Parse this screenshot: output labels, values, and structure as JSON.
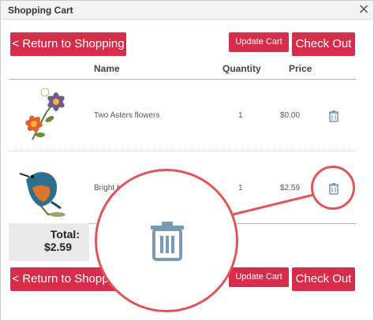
{
  "window": {
    "title": "Shopping Cart",
    "close_glyph": "×"
  },
  "buttons": {
    "return_label": "< Return to Shopping",
    "update_label": "Update Cart",
    "checkout_label": "Check Out"
  },
  "table": {
    "headers": {
      "name": "Name",
      "quantity": "Quantity",
      "price": "Price"
    },
    "rows": [
      {
        "name": "Two Asters flowers",
        "quantity": "1",
        "price": "$0.00",
        "image_icon": "asters-embroidery-icon"
      },
      {
        "name": "Bright b",
        "quantity": "1",
        "price": "$2.59",
        "image_icon": "kingfisher-embroidery-icon"
      }
    ]
  },
  "total": {
    "label": "Total:",
    "value": "$2.59"
  },
  "colors": {
    "accent": "#d62d4a",
    "callout": "#e05555",
    "trash": "#7a9ab2"
  }
}
